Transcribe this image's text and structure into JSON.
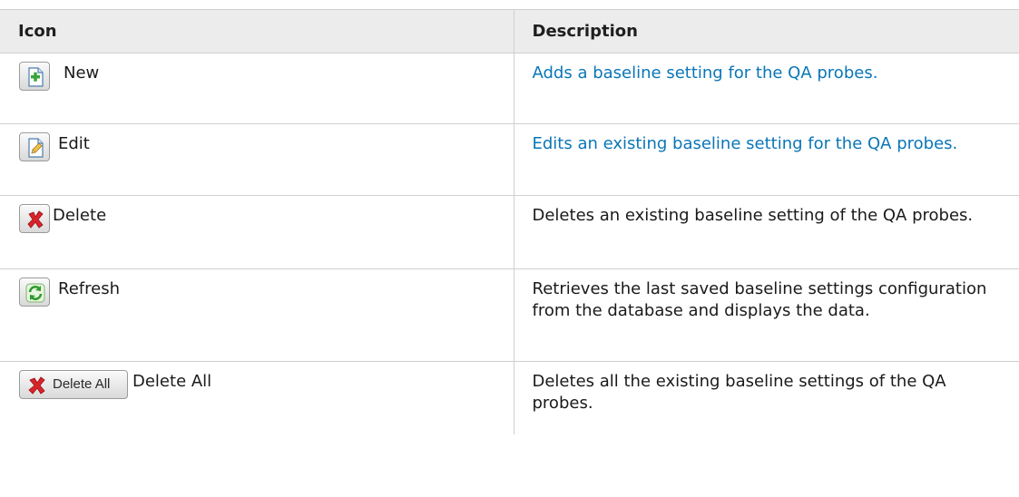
{
  "table": {
    "headers": {
      "icon": "Icon",
      "description": "Description"
    },
    "rows": [
      {
        "label": "New",
        "icon": "new-document-plus-icon",
        "description": "Adds a baseline setting for the QA probes."
      },
      {
        "label": "Edit",
        "icon": "edit-pencil-icon",
        "description": "Edits an existing baseline setting for the QA probes."
      },
      {
        "label": "Delete",
        "icon": "delete-x-icon",
        "description": "Deletes an existing baseline setting of the QA probes."
      },
      {
        "label": "Refresh",
        "icon": "refresh-arrows-icon",
        "description": "Retrieves the last saved baseline settings configuration from the database and displays the data."
      },
      {
        "label": "Delete All",
        "icon": "delete-x-icon",
        "button_text": "Delete All",
        "description": "Deletes all the existing baseline settings of the QA probes."
      }
    ]
  },
  "colors": {
    "link": "#0a76b7",
    "header_bg": "#ececec",
    "border": "#cfcfcf"
  }
}
